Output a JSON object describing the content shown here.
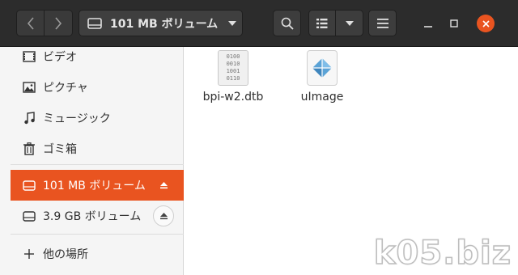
{
  "header": {
    "location_label": "101 MB ボリューム"
  },
  "sidebar": {
    "items": [
      {
        "label": "ビデオ",
        "icon": "video-icon"
      },
      {
        "label": "ピクチャ",
        "icon": "pictures-icon"
      },
      {
        "label": "ミュージック",
        "icon": "music-icon"
      },
      {
        "label": "ゴミ箱",
        "icon": "trash-icon"
      }
    ],
    "volumes": [
      {
        "label": "101 MB ボリューム",
        "icon": "drive-icon",
        "active": true
      },
      {
        "label": "3.9 GB ボリューム",
        "icon": "drive-icon",
        "active": false
      }
    ],
    "other_locations": "他の場所"
  },
  "files": [
    {
      "name": "bpi-w2.dtb",
      "icon": "binary-file-icon",
      "bin_lines": [
        "0100",
        "0010",
        "1001",
        "0110"
      ]
    },
    {
      "name": "uImage",
      "icon": "image-file-icon"
    }
  ],
  "watermark": "k05.biz",
  "colors": {
    "accent": "#e95420",
    "header_bg": "#2c2c2c"
  }
}
